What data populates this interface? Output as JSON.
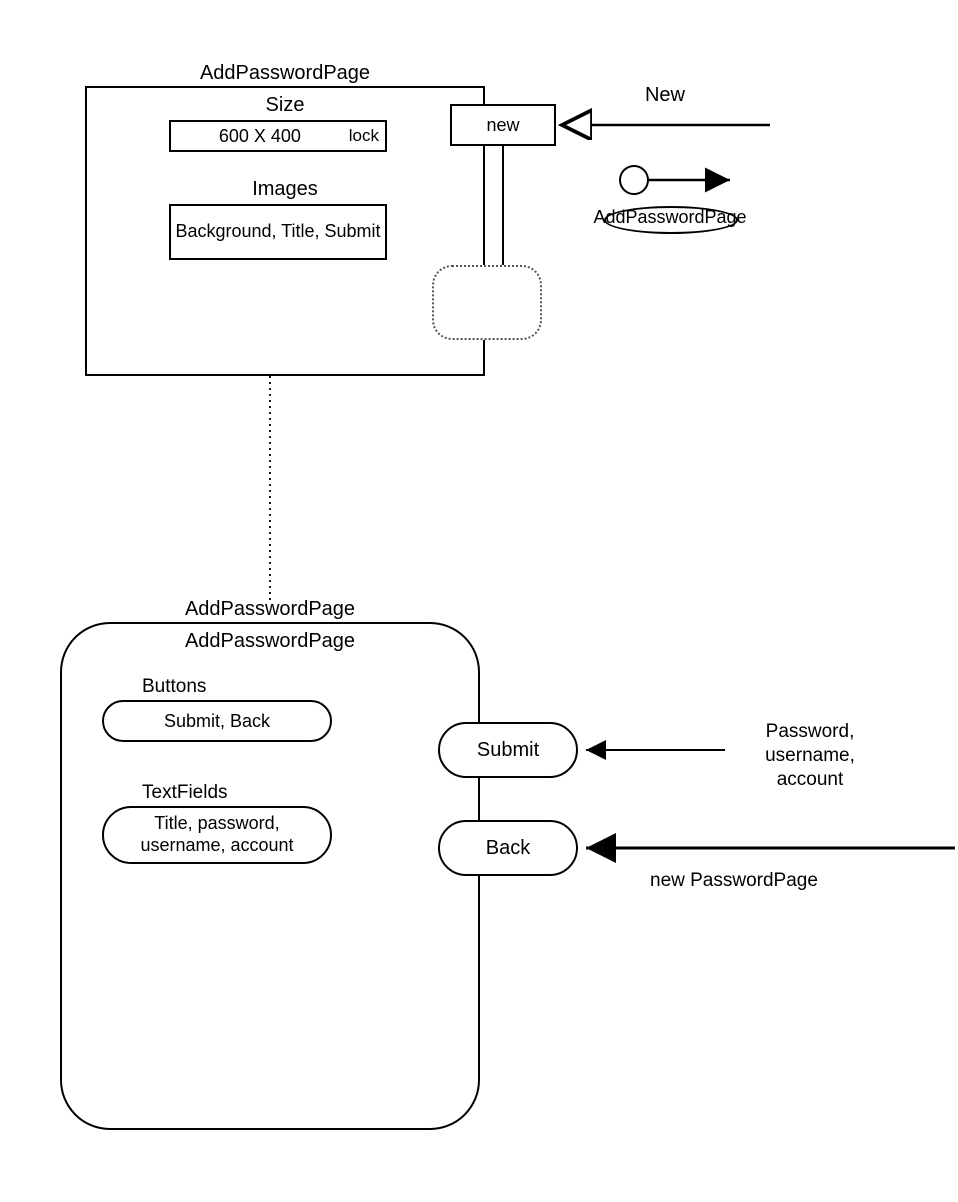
{
  "topBox": {
    "title": "AddPasswordPage",
    "sizeLabel": "Size",
    "sizeValue": "600 X 400",
    "lock": "lock",
    "imagesLabel": "Images",
    "imagesValue": "Background, Title, Submit"
  },
  "newBox": {
    "label": "new",
    "incomingLabel": "New"
  },
  "flowNode": {
    "label": "AddPasswordPage"
  },
  "bottomPanel": {
    "titleOuter": "AddPasswordPage",
    "titleInner": "AddPasswordPage",
    "buttonsLabel": "Buttons",
    "buttonsValue": "Submit, Back",
    "textFieldsLabel": "TextFields",
    "textFieldsValue": "Title, password, username, account"
  },
  "submitNode": {
    "label": "Submit",
    "incomingLabel": "Password, username, account"
  },
  "backNode": {
    "label": "Back",
    "incomingLabel": "new PasswordPage"
  }
}
